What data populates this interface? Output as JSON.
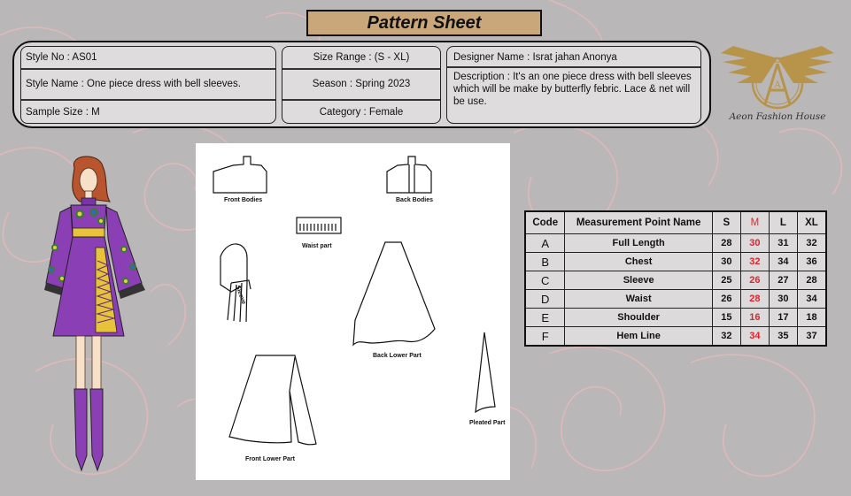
{
  "title": "Pattern Sheet",
  "header": {
    "style_no": "Style No : AS01",
    "style_name": "Style Name : One piece dress with bell sleeves.",
    "sample_size": "Sample Size : M",
    "size_range": "Size Range : (S - XL)",
    "season": "Season : Spring 2023",
    "category": "Category : Female",
    "designer": "Designer Name : Israt jahan Anonya",
    "description": "Description : It's an one piece dress with bell sleeves which will be make by butterfly febric. Lace & net will be use."
  },
  "logo": {
    "monogram": "A",
    "name": "Aeon Fashion House",
    "color": "#b8944a"
  },
  "patterns": {
    "front_bodies": "Front Bodies",
    "back_bodies": "Back Bodies",
    "waist_part": "Waist part",
    "sleeve": "Sleeve",
    "back_lower_part": "Back Lower Part",
    "front_lower_part": "Front Lower Part",
    "pleated_part": "Pleated Part"
  },
  "table": {
    "headers": [
      "Code",
      "Measurement Point Name",
      "S",
      "M",
      "L",
      "XL"
    ],
    "rows": [
      [
        "A",
        "Full Length",
        "28",
        "30",
        "31",
        "32"
      ],
      [
        "B",
        "Chest",
        "30",
        "32",
        "34",
        "36"
      ],
      [
        "C",
        "Sleeve",
        "25",
        "26",
        "27",
        "28"
      ],
      [
        "D",
        "Waist",
        "26",
        "28",
        "30",
        "34"
      ],
      [
        "E",
        "Shoulder",
        "15",
        "16",
        "17",
        "18"
      ],
      [
        "F",
        "Hem Line",
        "32",
        "34",
        "35",
        "37"
      ]
    ],
    "highlight_color": "#e4222a"
  },
  "colors": {
    "dress": "#8a3fb5",
    "banner": "#c9a77a",
    "background": "#b9b7b8"
  }
}
